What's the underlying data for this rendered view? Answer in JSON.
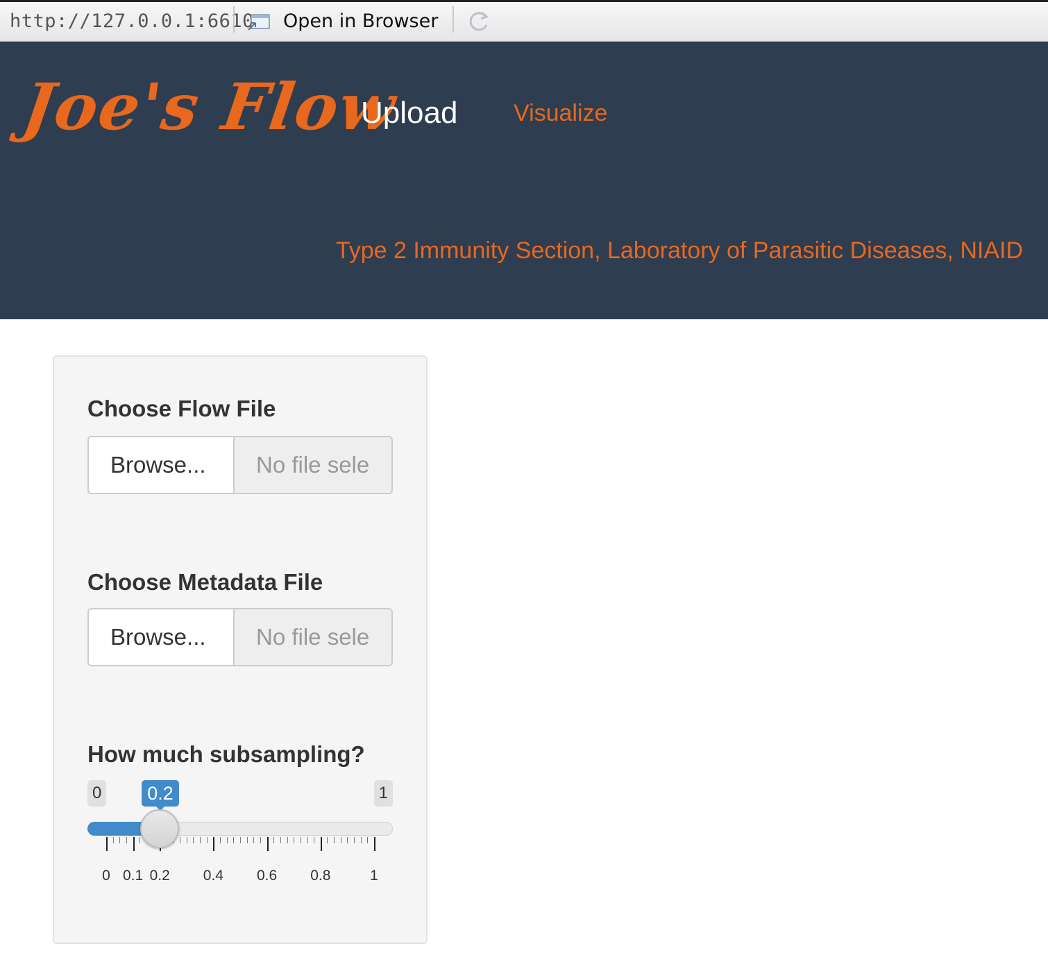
{
  "browser": {
    "url": "http://127.0.0.1:6610",
    "open_in_browser_label": "Open in Browser"
  },
  "navbar": {
    "brand": "Joe's Flow",
    "tabs": [
      {
        "label": "Upload",
        "active": true
      },
      {
        "label": "Visualize",
        "active": false
      }
    ],
    "subtitle": "Type 2 Immunity Section, Laboratory of Parasitic Diseases, NIAID"
  },
  "colors": {
    "navbar_bg": "#2e3d50",
    "accent_orange": "#e8681e",
    "slider_blue": "#428bca"
  },
  "sidebar": {
    "flow_file": {
      "label": "Choose Flow File",
      "button_label": "Browse...",
      "filename_placeholder": "No file sele"
    },
    "metadata_file": {
      "label": "Choose Metadata File",
      "button_label": "Browse...",
      "filename_placeholder": "No file sele"
    },
    "subsampling": {
      "label": "How much subsampling?",
      "min": 0,
      "max": 1,
      "value": 0.2,
      "min_label": "0",
      "max_label": "1",
      "value_label": "0.2",
      "tick_labels": [
        "0",
        "0.1",
        "0.2",
        "0.4",
        "0.6",
        "0.8",
        "1"
      ],
      "tick_values": [
        0,
        0.1,
        0.2,
        0.4,
        0.6,
        0.8,
        1
      ]
    }
  }
}
